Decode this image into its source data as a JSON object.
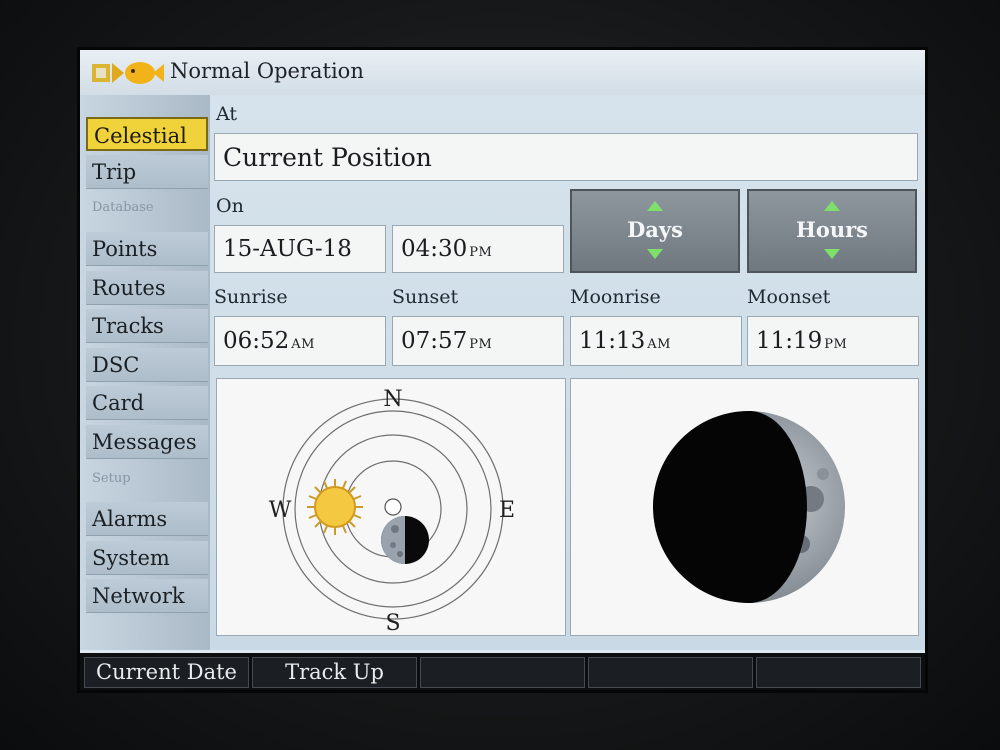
{
  "title": "Normal Operation",
  "sidebar": {
    "items": [
      {
        "label": "Celestial",
        "selected": true
      },
      {
        "label": "Trip"
      },
      {
        "header": "Database"
      },
      {
        "label": "Points"
      },
      {
        "label": "Routes"
      },
      {
        "label": "Tracks"
      },
      {
        "label": "DSC"
      },
      {
        "label": "Card"
      },
      {
        "label": "Messages"
      },
      {
        "header": "Setup"
      },
      {
        "label": "Alarms"
      },
      {
        "label": "System"
      },
      {
        "label": "Network"
      }
    ]
  },
  "main": {
    "at_label": "At",
    "position_value": "Current Position",
    "on_label": "On",
    "date_value": "15-AUG-18",
    "time_value": "04:30",
    "time_ampm": "PM",
    "days_button": "Days",
    "hours_button": "Hours",
    "sunrise_label": "Sunrise",
    "sunrise_time": "06:52",
    "sunrise_ampm": "AM",
    "sunset_label": "Sunset",
    "sunset_time": "07:57",
    "sunset_ampm": "PM",
    "moonrise_label": "Moonrise",
    "moonrise_time": "11:13",
    "moonrise_ampm": "AM",
    "moonset_label": "Moonset",
    "moonset_time": "11:19",
    "moonset_ampm": "PM",
    "compass": {
      "n": "N",
      "s": "S",
      "e": "E",
      "w": "W"
    }
  },
  "softkeys": [
    "Current Date",
    "Track Up",
    "",
    "",
    ""
  ],
  "colors": {
    "selected": "#f0d23a",
    "arrow": "#7ee06a",
    "button": "#7f888f"
  }
}
